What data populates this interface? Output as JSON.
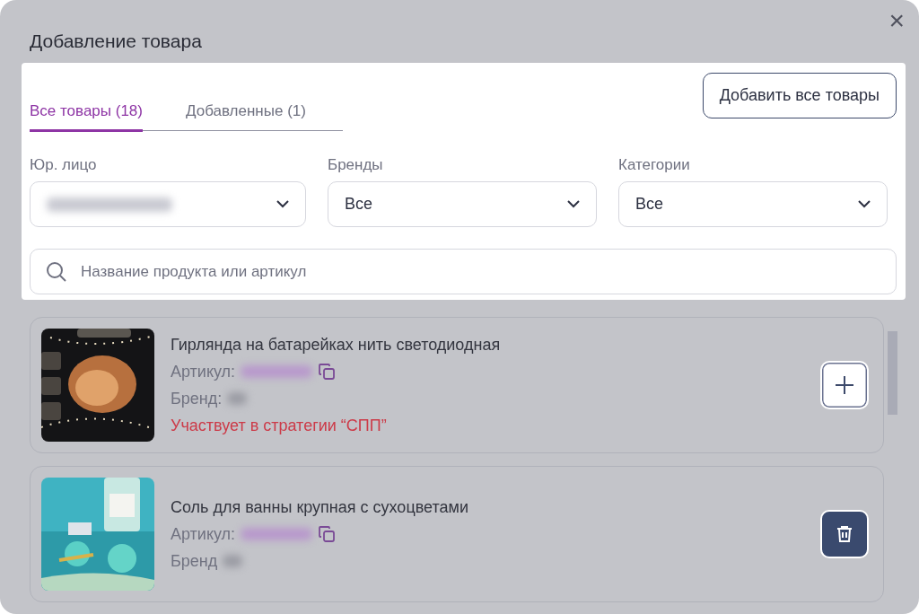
{
  "dialog": {
    "title": "Добавление товара",
    "close": "×"
  },
  "tabs": [
    {
      "label": "Все товары (18)",
      "selected": true
    },
    {
      "label": "Добавленные (1)",
      "selected": false
    }
  ],
  "add_all_button": "Добавить все товары",
  "filters": [
    {
      "label": "Юр. лицо"
    },
    {
      "label": "Бренды",
      "value": "Все"
    },
    {
      "label": "Категории",
      "value": "Все"
    }
  ],
  "search": {
    "placeholder": "Название продукта или артикул"
  },
  "products": [
    {
      "name": "Гирлянда на батарейках нить светодиодная",
      "article_label": "Артикул:",
      "brand_label": "Бренд:",
      "note": "Участвует в стратегии “СПП”",
      "added": false
    },
    {
      "name": "Соль для ванны крупная с сухоцветами",
      "article_label": "Артикул:",
      "brand_label": "Бренд",
      "added": true
    }
  ]
}
